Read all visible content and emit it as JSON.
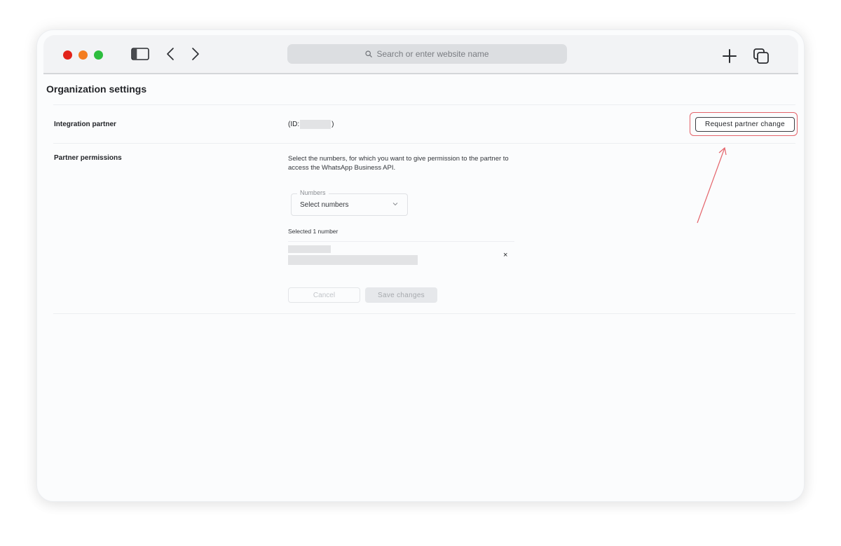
{
  "browser": {
    "search_placeholder": "Search or enter website name",
    "traffic_lights": [
      "#e2231a",
      "#f47d20",
      "#2dbd3e"
    ],
    "icons": [
      "sidebar-toggle-icon",
      "back-icon",
      "forward-icon",
      "search-icon",
      "new-tab-icon",
      "tabs-overview-icon"
    ]
  },
  "page": {
    "title": "Organization settings"
  },
  "integration": {
    "label": "Integration partner",
    "id_prefix": "(ID:",
    "id_suffix": ")",
    "request_button": "Request partner change"
  },
  "permissions": {
    "label": "Partner permissions",
    "description": "Select the numbers, for which you want to give permission to the partner to access the WhatsApp Business API.",
    "select_legend": "Numbers",
    "select_placeholder": "Select numbers",
    "selected_count": "Selected 1 number",
    "remove_symbol": "×",
    "cancel_button": "Cancel",
    "save_button": "Save changes"
  },
  "colors": {
    "annotation": "#e4636a"
  }
}
